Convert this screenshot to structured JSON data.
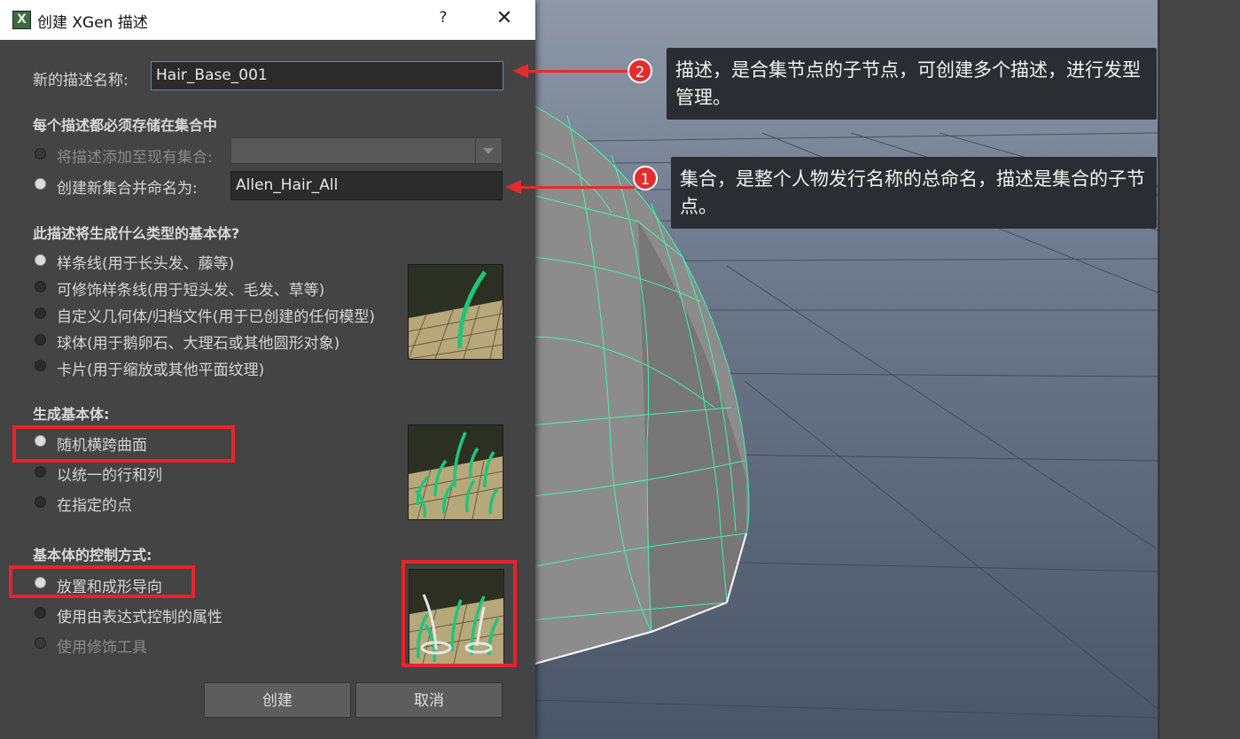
{
  "dialog": {
    "title": "创建 XGen 描述",
    "help_label": "?",
    "close_label": "✕",
    "app_icon_letter": "X"
  },
  "name_section": {
    "label": "新的描述名称:",
    "value": "Hair_Base_001"
  },
  "collection_section": {
    "header": "每个描述都必须存储在集合中",
    "option_existing": "将描述添加至现有集合:",
    "option_new": "创建新集合并命名为:",
    "new_collection_value": "Allen_Hair_All",
    "existing_value": ""
  },
  "primitive_type_section": {
    "header": "此描述将生成什么类型的基本体?",
    "options": [
      "样条线(用于长头发、藤等)",
      "可修饰样条线(用于短头发、毛发、草等)",
      "自定义几何体/归档文件(用于已创建的任何模型)",
      "球体(用于鹅卵石、大理石或其他圆形对象)",
      "卡片(用于缩放或其他平面纹理)"
    ],
    "selected_index": 0
  },
  "generate_section": {
    "header": "生成基本体:",
    "options": [
      "随机横跨曲面",
      "以统一的行和列",
      "在指定的点"
    ],
    "selected_index": 0
  },
  "control_section": {
    "header": "基本体的控制方式:",
    "options": [
      "放置和成形导向",
      "使用由表达式控制的属性",
      "使用修饰工具"
    ],
    "selected_index": 0
  },
  "buttons": {
    "create": "创建",
    "cancel": "取消"
  },
  "annotations": [
    {
      "number": "2",
      "text": "描述，是合集节点的子节点，可创建多个描述，进行发型管理。"
    },
    {
      "number": "1",
      "text": "集合，是整个人物发行名称的总命名，描述是集合的子节点。"
    }
  ],
  "colors": {
    "highlight_red": "#e8242a",
    "wireframe_green": "#3dffb0",
    "dialog_bg": "#444444"
  }
}
